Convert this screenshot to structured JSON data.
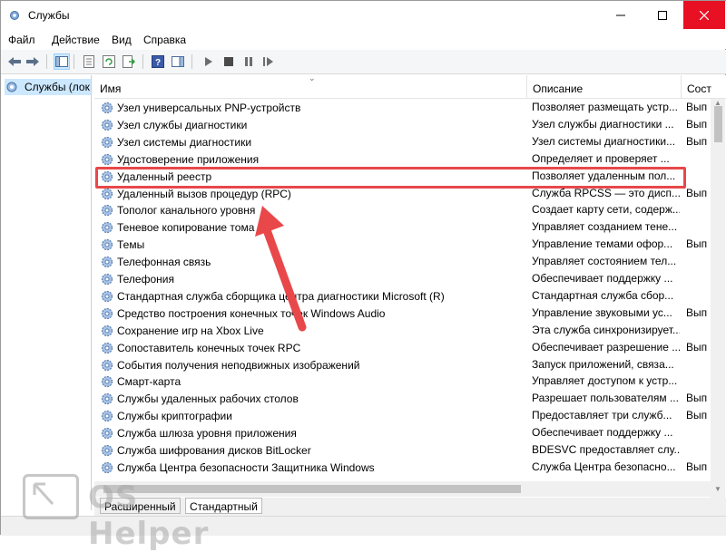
{
  "window": {
    "title": "Службы"
  },
  "menu": [
    "Файл",
    "Действие",
    "Вид",
    "Справка"
  ],
  "tree": {
    "selected_label": "Службы (лок"
  },
  "columns": {
    "name": "Имя",
    "description": "Описание",
    "status": "Сост"
  },
  "rows": [
    {
      "name": "Узел универсальных PNP-устройств",
      "desc": "Позволяет размещать устр...",
      "status": "Вып"
    },
    {
      "name": "Узел службы диагностики",
      "desc": "Узел службы диагностики ...",
      "status": "Вып"
    },
    {
      "name": "Узел системы диагностики",
      "desc": "Узел системы диагностики...",
      "status": "Вып"
    },
    {
      "name": "Удостоверение приложения",
      "desc": "Определяет и проверяет ...",
      "status": ""
    },
    {
      "name": "Удаленный реестр",
      "desc": "Позволяет удаленным пол...",
      "status": ""
    },
    {
      "name": "Удаленный вызов процедур (RPC)",
      "desc": "Служба RPCSS — это дисп...",
      "status": "Вып"
    },
    {
      "name": "Тополог канального уровня",
      "desc": "Создает карту сети, содерж...",
      "status": ""
    },
    {
      "name": "Теневое копирование тома",
      "desc": "Управляет созданием тене...",
      "status": ""
    },
    {
      "name": "Темы",
      "desc": "Управление темами офор...",
      "status": "Вып"
    },
    {
      "name": "Телефонная связь",
      "desc": "Управляет состоянием тел...",
      "status": ""
    },
    {
      "name": "Телефония",
      "desc": "Обеспечивает поддержку ...",
      "status": ""
    },
    {
      "name": "Стандартная служба сборщика центра диагностики Microsoft (R)",
      "desc": "Стандартная служба сбор...",
      "status": ""
    },
    {
      "name": "Средство построения конечных точек Windows Audio",
      "desc": "Управление звуковыми ус...",
      "status": "Вып"
    },
    {
      "name": "Сохранение игр на Xbox Live",
      "desc": "Эта служба синхронизирует...",
      "status": ""
    },
    {
      "name": "Сопоставитель конечных точек RPC",
      "desc": "Обеспечивает разрешение ...",
      "status": "Вып"
    },
    {
      "name": "События получения неподвижных изображений",
      "desc": "Запуск приложений, связа...",
      "status": ""
    },
    {
      "name": "Смарт-карта",
      "desc": "Управляет доступом к устр...",
      "status": ""
    },
    {
      "name": "Службы удаленных рабочих столов",
      "desc": "Разрешает пользователям ...",
      "status": "Вып"
    },
    {
      "name": "Службы криптографии",
      "desc": "Предоставляет три служб...",
      "status": "Вып"
    },
    {
      "name": "Служба шлюза уровня приложения",
      "desc": "Обеспечивает поддержку ...",
      "status": ""
    },
    {
      "name": "Служба шифрования дисков BitLocker",
      "desc": "BDESVC предоставляет слу...",
      "status": ""
    },
    {
      "name": "Служба Центра безопасности Защитника Windows",
      "desc": "Служба Центра безопасно...",
      "status": "Вып"
    }
  ],
  "tabs": {
    "extended": "Расширенный",
    "standard": "Стандартный"
  },
  "watermark": {
    "text": "OS Helper"
  },
  "colors": {
    "highlight_box": "#e8484a",
    "arrow": "#e8484a",
    "selected_tree": "#cce8ff"
  }
}
